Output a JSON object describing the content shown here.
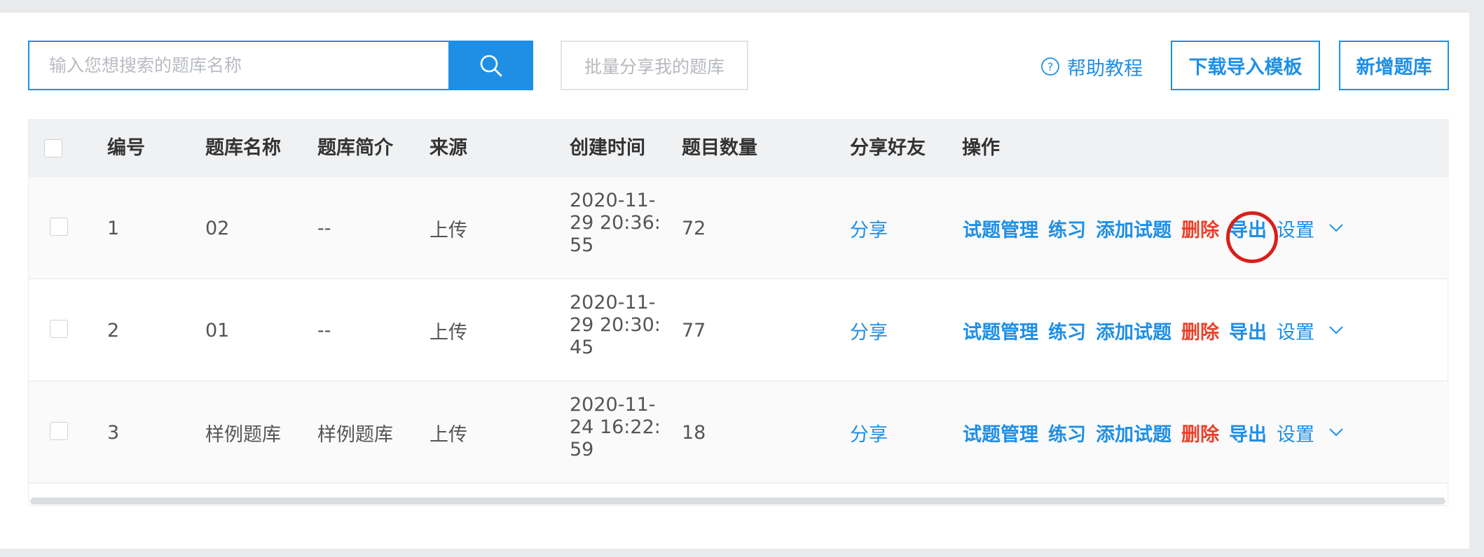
{
  "toolbar": {
    "search_placeholder": "输入您想搜索的题库名称",
    "search_icon": "search-icon",
    "batch_share_label": "批量分享我的题库",
    "help_label": "帮助教程",
    "help_icon": "question-circle-icon",
    "download_template_label": "下载导入模板",
    "add_bank_label": "新增题库"
  },
  "table": {
    "headers": [
      "编号",
      "题库名称",
      "题库简介",
      "来源",
      "创建时间",
      "题目数量",
      "分享好友",
      "操作"
    ],
    "rows": [
      {
        "id": "1",
        "name": "02",
        "intro": "--",
        "source": "上传",
        "time_l1": "2020-11-",
        "time_l2": "29 20:36:",
        "time_l3": "55",
        "count": "72",
        "share": "分享"
      },
      {
        "id": "2",
        "name": "01",
        "intro": "--",
        "source": "上传",
        "time_l1": "2020-11-",
        "time_l2": "29 20:30:",
        "time_l3": "45",
        "count": "77",
        "share": "分享"
      },
      {
        "id": "3",
        "name": "样例题库",
        "intro": "样例题库",
        "source": "上传",
        "time_l1": "2020-11-",
        "time_l2": "24 16:22:",
        "time_l3": "59",
        "count": "18",
        "share": "分享"
      }
    ],
    "actions": {
      "manage": "试题管理",
      "practice": "练习",
      "add_questions": "添加试题",
      "delete": "删除",
      "export": "导出",
      "settings": "设置"
    }
  },
  "colors": {
    "primary": "#1f8fe5",
    "danger": "#e8412b",
    "annotation": "#d8201b"
  }
}
